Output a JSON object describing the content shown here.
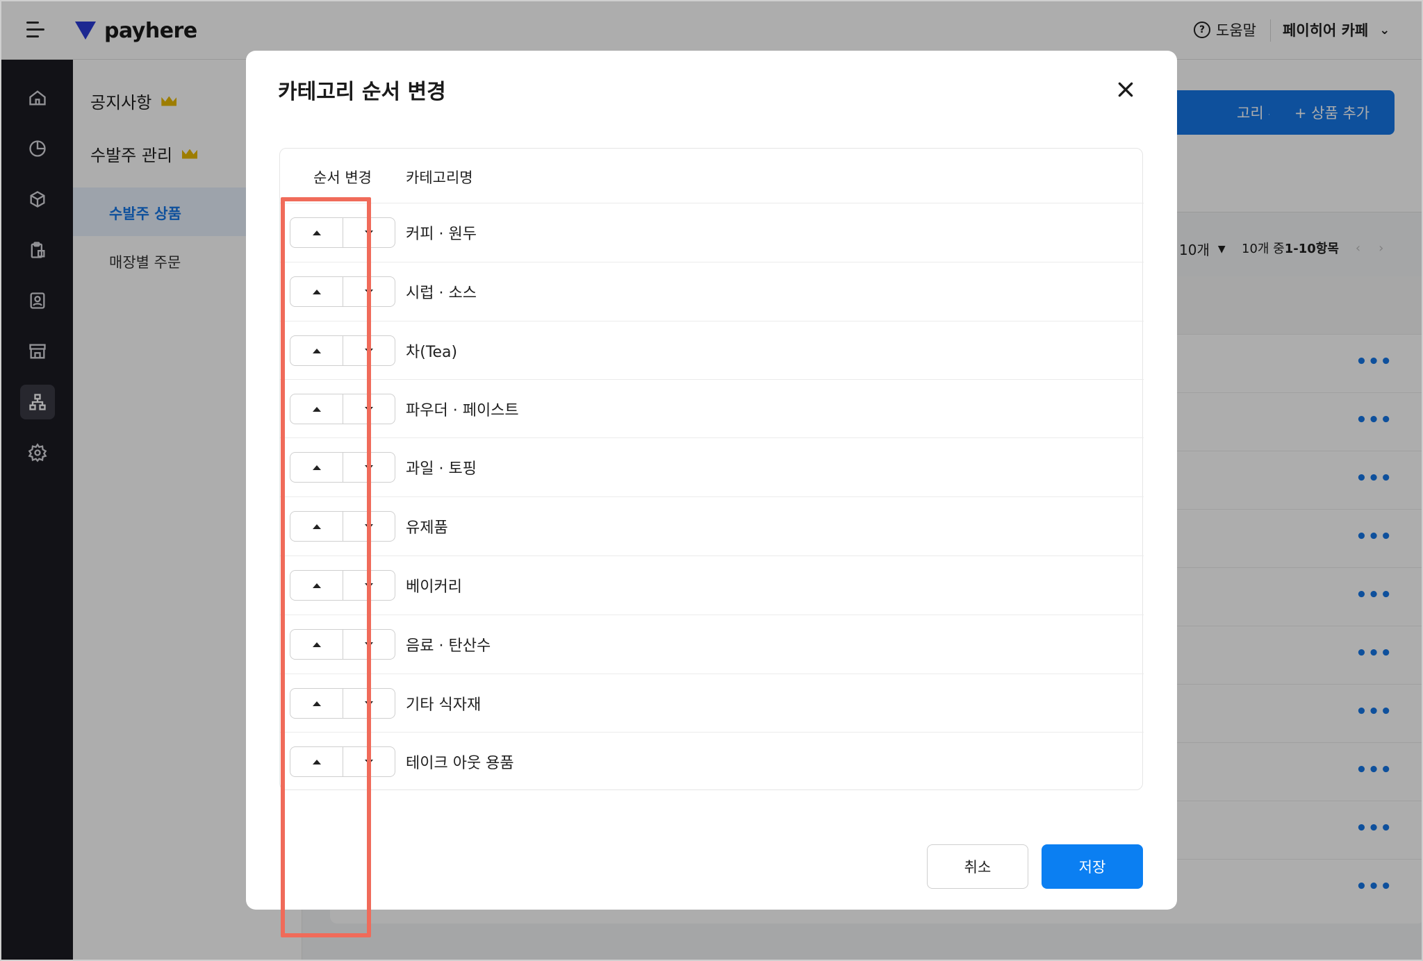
{
  "app": {
    "brand": "payhere",
    "help_label": "도움말",
    "store_name": "페이히어 카페"
  },
  "sidebar": {
    "icons": [
      "home-icon",
      "chart-pie-icon",
      "box-icon",
      "clipboard-icon",
      "contact-icon",
      "store-icon",
      "sitemap-icon",
      "gear-icon"
    ],
    "active_index": 6
  },
  "subnav": {
    "notice": "공지사항",
    "order_mgmt": "수발주 관리",
    "order_products": "수발주 상품",
    "store_orders": "매장별 주문"
  },
  "content": {
    "add_category_label": "고리 추가",
    "add_product_label": "+ 상품 추가",
    "page_size": "10개",
    "range_prefix": "10개 중 ",
    "range_value": "1-10항목",
    "more_label": "•••"
  },
  "modal": {
    "title": "카테고리 순서 변경",
    "col_order": "순서 변경",
    "col_name": "카테고리명",
    "categories": [
      "커피 · 원두",
      "시럽 · 소스",
      "차(Tea)",
      "파우더 · 페이스트",
      "과일 · 토핑",
      "유제품",
      "베이커리",
      "음료 · 탄산수",
      "기타 식자재",
      "테이크 아웃 용품"
    ],
    "cancel_label": "취소",
    "save_label": "저장"
  },
  "colors": {
    "accent": "#0b7ff2",
    "highlight": "#f06b5a",
    "sidebar_bg": "#1b1b22",
    "crown": "#e8b800"
  }
}
